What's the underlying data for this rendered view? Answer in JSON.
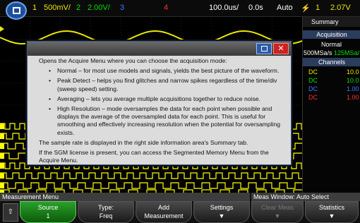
{
  "topbar": {
    "ch1_num": "1",
    "ch1_scale": "500mV/",
    "ch2_num": "2",
    "ch2_scale": "2.00V/",
    "ch3_num": "3",
    "ch4_num": "4",
    "timebase": "100.0us/",
    "delay": "0.0s",
    "trigger_mode": "Auto",
    "trigger_symbol": "⚡",
    "trig_ch": "1",
    "trig_level": "2.07V"
  },
  "side": {
    "tab_label": "Summary",
    "acq_header": "Acquisition",
    "acq_mode": "Normal",
    "sample_rate": "500MSa/s",
    "sample_rate2": "125MSa/",
    "channels_header": "Channels",
    "channels": [
      {
        "coupling": "DC",
        "value": "10.0",
        "color": "#e8e800"
      },
      {
        "coupling": "DC",
        "value": "10.0",
        "color": "#00e000"
      },
      {
        "coupling": "DC",
        "value": "1.00",
        "color": "#3b7bff"
      },
      {
        "coupling": "DC",
        "value": "1.00",
        "color": "#ff3030"
      }
    ]
  },
  "dialog": {
    "intro": "Opens the Acquire Menu where you can choose the acquisition mode:",
    "bullets": [
      "Normal – for most use models and signals, yields the best picture of the waveform.",
      "Peak Detect – helps you find glitches and narrow spikes regardless of the time/div (sweep speed) setting.",
      "Averaging – lets you average multiple acquisitions together to reduce noise.",
      "High Resolution – mode oversamples the data for each point when possible and displays the average of the oversampled data for each point. This is useful for smoothing and effectively increasing resolution when the potential for oversampling exists."
    ],
    "note1": "The sample rate is displayed in the right side information area's Summary tab.",
    "note2": "If the SGM license is present, you can access the Segmented Memory Menu from the Acquire Menu.",
    "close_label": "✕"
  },
  "bottom": {
    "menu_title": "Measurement Menu",
    "meas_window": "Meas Window: Auto Select",
    "softkeys": [
      {
        "label": "Source",
        "value": "1"
      },
      {
        "label": "Type:",
        "value": "Freq"
      },
      {
        "label": "Add",
        "value": "Measurement"
      },
      {
        "label": "Settings",
        "value": "▼"
      },
      {
        "label": "Clear Meas",
        "value": "▼"
      },
      {
        "label": "Statistics",
        "value": "▼"
      }
    ]
  },
  "colors": {
    "ch1": "#e8e800",
    "ch2": "#00e000",
    "ch3": "#3b7bff",
    "ch4": "#ff3030",
    "digital": "#ffff00",
    "dialog_header": "#1a3f80"
  }
}
